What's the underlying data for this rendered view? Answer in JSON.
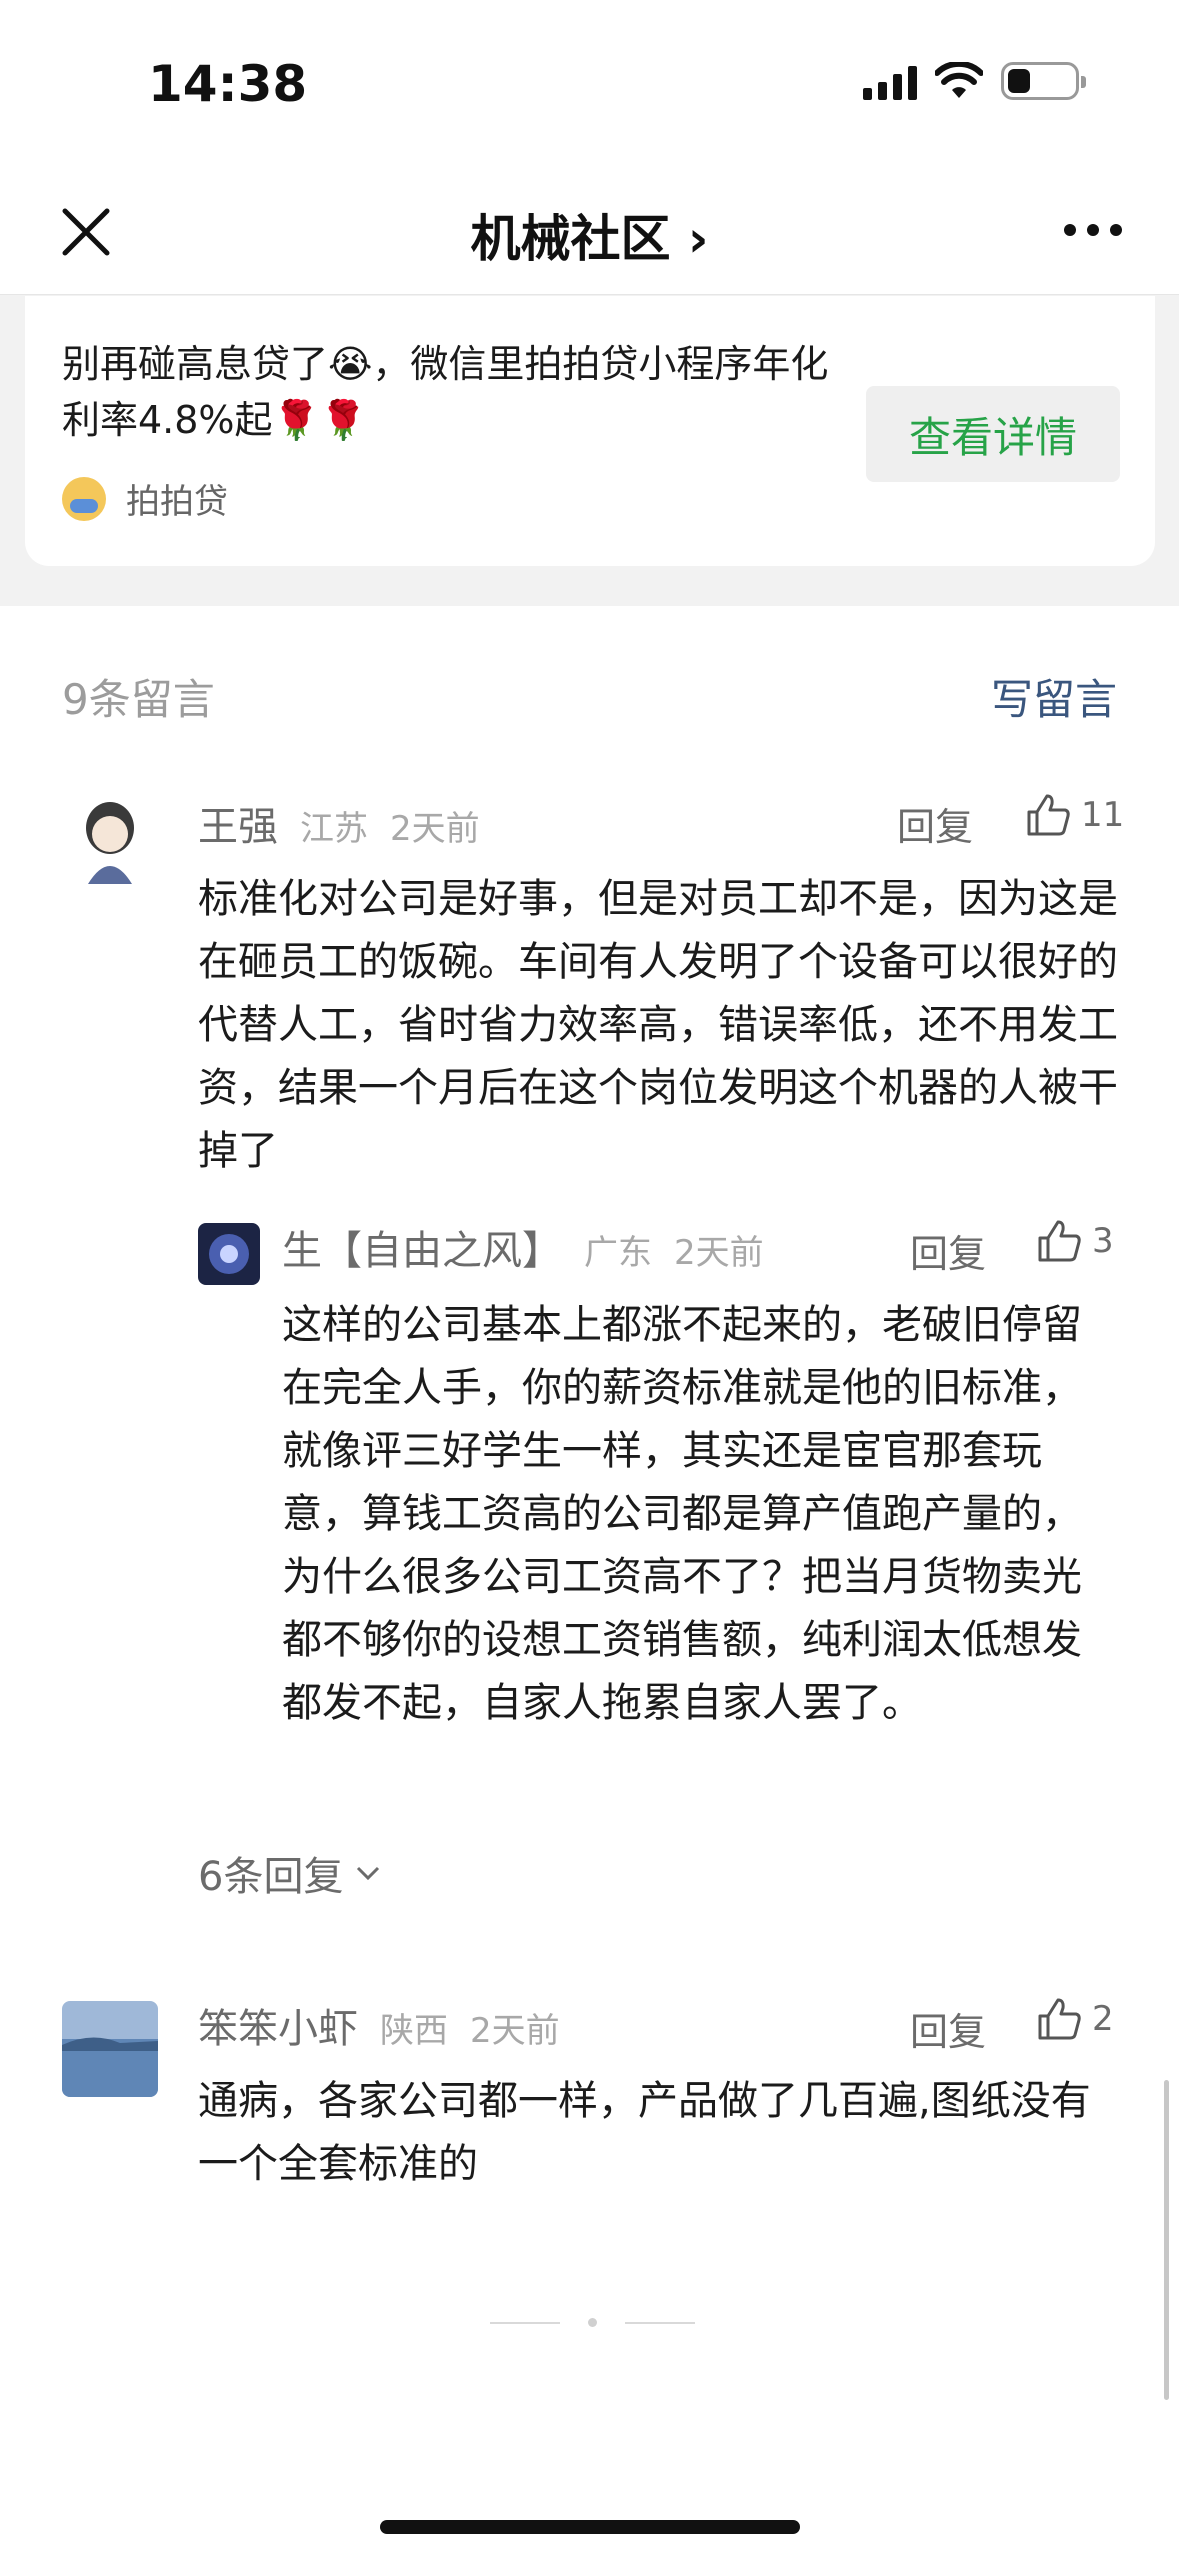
{
  "status_bar": {
    "time": "14:38"
  },
  "nav": {
    "title": "机械社区 ›"
  },
  "ad": {
    "text": "别再碰高息贷了😭，微信里拍拍贷小程序年化利率4.8%起🌹🌹",
    "source": "拍拍贷",
    "button": "查看详情"
  },
  "comments_section": {
    "count": "9条留言",
    "write": "写留言",
    "more_replies": "6条回复"
  },
  "comments": [
    {
      "name": "王强",
      "location": "江苏",
      "time": "2天前",
      "reply": "回复",
      "likes": "11",
      "text": "标准化对公司是好事，但是对员工却不是，因为这是在砸员工的饭碗。车间有人发明了个设备可以很好的代替人工，省时省力效率高，错误率低，还不用发工资，结果一个月后在这个岗位发明这个机器的人被干掉了"
    },
    {
      "name": "生【自由之风】",
      "location": "广东",
      "time": "2天前",
      "reply": "回复",
      "likes": "3",
      "text": "这样的公司基本上都涨不起来的，老破旧停留在完全人手，你的薪资标准就是他的旧标准，就像评三好学生一样，其实还是宦官那套玩意，算钱工资高的公司都是算产值跑产量的，为什么很多公司工资高不了？把当月货物卖光都不够你的设想工资销售额，纯利润太低想发都发不起，自家人拖累自家人罢了。"
    },
    {
      "name": "笨笨小虾",
      "location": "陕西",
      "time": "2天前",
      "reply": "回复",
      "likes": "2",
      "text": "通病，各家公司都一样，产品做了几百遍,图纸没有一个全套标准的"
    }
  ]
}
